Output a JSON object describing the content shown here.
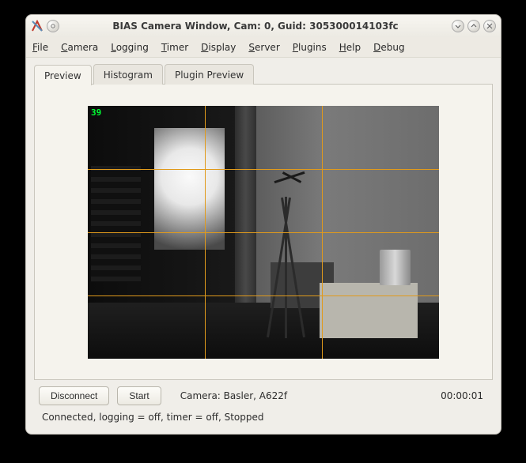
{
  "titlebar": {
    "title": "BIAS Camera Window, Cam: 0, Guid: 305300014103fc"
  },
  "menu": {
    "file": "File",
    "camera": "Camera",
    "logging": "Logging",
    "timer": "Timer",
    "display": "Display",
    "server": "Server",
    "plugins": "Plugins",
    "help": "Help",
    "debug": "Debug"
  },
  "tabs": {
    "preview": "Preview",
    "histogram": "Histogram",
    "plugin_preview": "Plugin Preview"
  },
  "preview": {
    "fps_overlay": "39"
  },
  "buttons": {
    "disconnect": "Disconnect",
    "start": "Start"
  },
  "camera_info": {
    "label": "Camera:  Basler,  A622f"
  },
  "timer": {
    "value": "00:00:01"
  },
  "status": {
    "text": "Connected, logging = off, timer = off, Stopped"
  }
}
